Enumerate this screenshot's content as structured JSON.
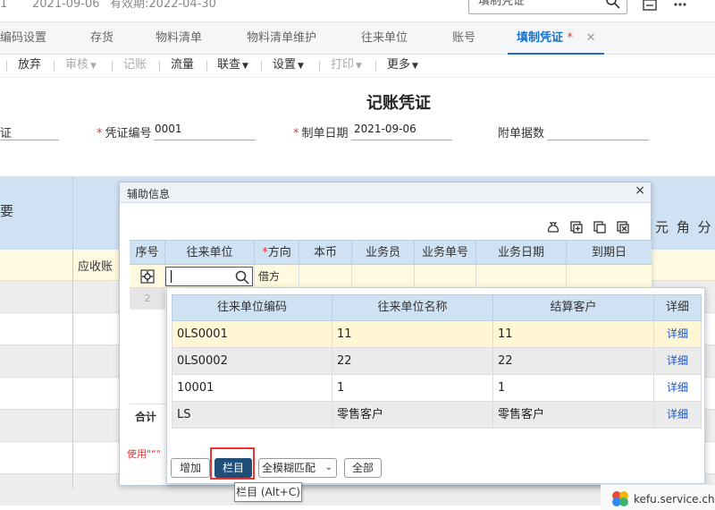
{
  "topbar": {
    "prefix": "1",
    "date": "2021-09-06",
    "validity": "有效期:2022-04-30",
    "search_placeholder": "填制凭证",
    "icons": [
      "search-icon",
      "export-icon",
      "more-icon"
    ]
  },
  "tabs": [
    {
      "label": "编码设置"
    },
    {
      "label": "存货"
    },
    {
      "label": "物料清单"
    },
    {
      "label": "物料清单维护"
    },
    {
      "label": "往来单位"
    },
    {
      "label": "账号"
    },
    {
      "label": "填制凭证",
      "active": true,
      "star": "*",
      "close": "✕"
    }
  ],
  "toolbar": {
    "discard": "放弃",
    "review": "审核",
    "post": "记账",
    "flow": "流量",
    "query": "联查",
    "settings": "设置",
    "print": "打印",
    "more": "更多"
  },
  "voucher": {
    "title": "记账凭证",
    "type_tail": "证",
    "number_label": "凭证编号",
    "number_value": "0001",
    "date_label": "制单日期",
    "date_value": "2021-09-06",
    "attachments_label": "附单据数"
  },
  "background": {
    "summary_tail": "要",
    "account_text": "应收账",
    "unit_headers": [
      "元",
      "角",
      "分"
    ]
  },
  "dialog": {
    "title": "辅助信息",
    "close": "×",
    "columns": [
      "序号",
      "往来单位",
      "方向",
      "本币",
      "业务员",
      "业务单号",
      "业务日期",
      "到期日"
    ],
    "required_mark": "*",
    "row1_direction": "借方",
    "row2_index": "2",
    "total_label": "合计",
    "tip": "使用\"“\"",
    "buttons": {
      "add": "增加",
      "columns": "栏目",
      "match": "全模糊匹配",
      "all": "全部"
    }
  },
  "dropdown": {
    "headers": [
      "往来单位编码",
      "往来单位名称",
      "结算客户",
      "详细"
    ],
    "rows": [
      {
        "code": "0LS0001",
        "name": "11",
        "customer": "11",
        "detail": "详细"
      },
      {
        "code": "0LS0002",
        "name": "22",
        "customer": "22",
        "detail": "详细"
      },
      {
        "code": "10001",
        "name": "1",
        "customer": "1",
        "detail": "详细"
      },
      {
        "code": "LS",
        "name": "零售客户",
        "customer": "零售客户",
        "detail": "详细"
      }
    ]
  },
  "tooltip": "栏目 (Alt+C)",
  "kefu": "kefu.service.cha",
  "colors": {
    "accent": "#1a73c9",
    "header_blue": "#cfe2f3",
    "highlight_yellow": "#fff6d6",
    "required_red": "#e33333",
    "primary_button": "#1f4e79"
  }
}
